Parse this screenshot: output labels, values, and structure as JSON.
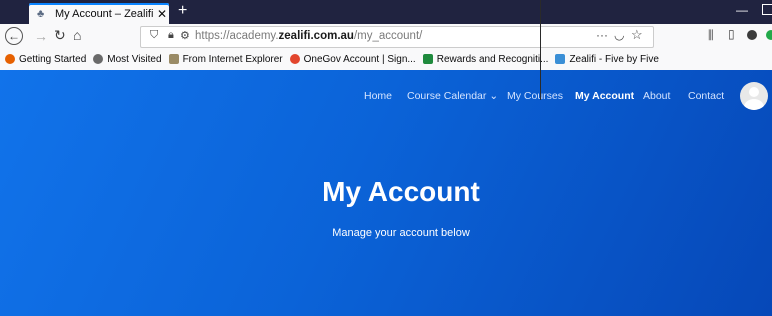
{
  "browser": {
    "tab_title": "My Account – Zealifi Acade",
    "new_tab": "+",
    "url_prefix": "https://academy.",
    "url_domain": "zealifi.com.au",
    "url_path": "/my_account/",
    "page_actions": "···",
    "bookmarks": [
      {
        "label": "Getting Started",
        "color": "#e66000"
      },
      {
        "label": "Most Visited",
        "color": "#6a6a6a"
      },
      {
        "label": "From Internet Explorer",
        "color": "#9a8b66"
      },
      {
        "label": "OneGov Account | Sign...",
        "color": "#e2452d"
      },
      {
        "label": "Rewards and Recogniti...",
        "color": "#1f8a3d"
      },
      {
        "label": "Zealifi - Five by Five",
        "color": "#3a8fd6"
      }
    ]
  },
  "site": {
    "nav": {
      "home": "Home",
      "course_calendar": "Course Calendar",
      "course_calendar_chevron": "⌄",
      "my_courses": "My Courses",
      "my_account": "My Account",
      "about": "About",
      "contact": "Contact"
    },
    "hero": {
      "title": "My Account",
      "subtitle": "Manage your account below"
    },
    "colors": {
      "hero_start": "#1173ea",
      "hero_end": "#0648b8"
    }
  }
}
